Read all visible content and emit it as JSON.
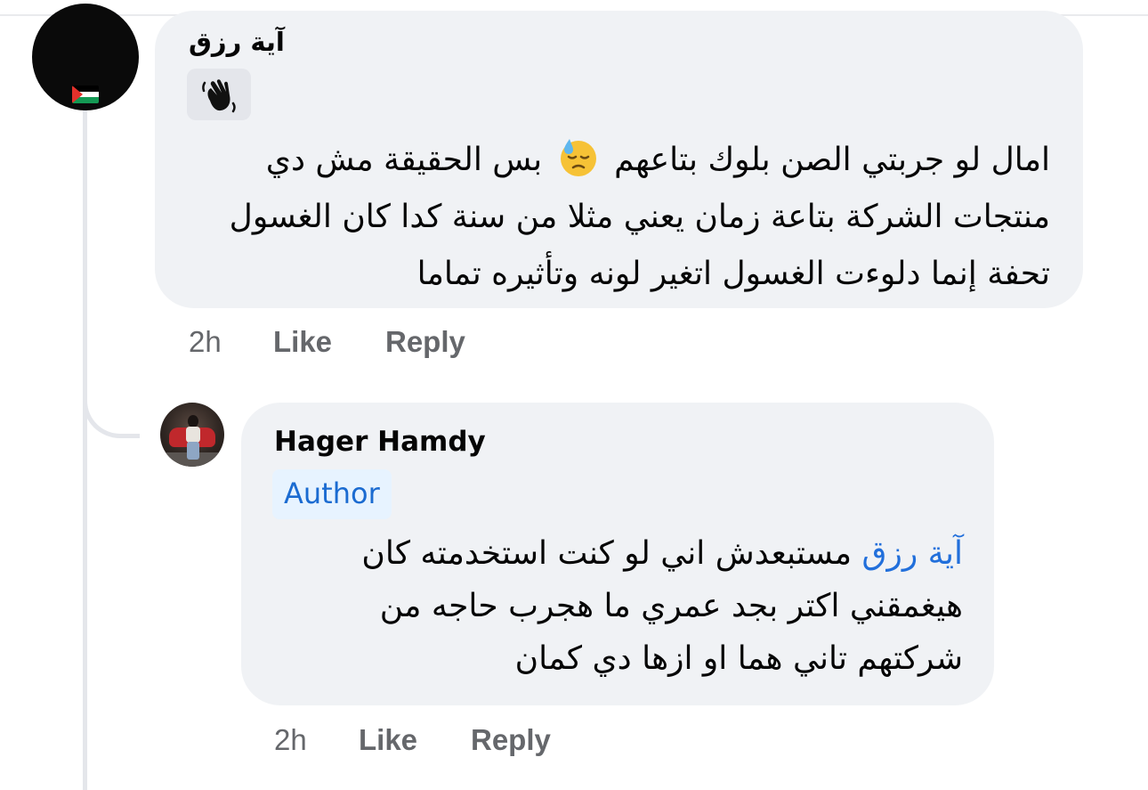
{
  "comment": {
    "author_name": "آية رزق",
    "avatar_badge": "palestine-flag",
    "badge_icon": "waving-hand-icon",
    "text_before_emoji": "امال لو جربتي الصن بلوك بتاعهم",
    "emoji": "downcast-face-with-sweat-icon",
    "text_after_emoji": "بس الحقيقة مش دي منتجات الشركة بتاعة زمان يعني مثلا من سنة كدا كان الغسول تحفة إنما دلوءت الغسول اتغير لونه وتأثيره تماما",
    "time": "2h",
    "like_label": "Like",
    "reply_label": "Reply"
  },
  "reply": {
    "author_name": "Hager Hamdy",
    "author_badge": "Author",
    "mention": "آية رزق",
    "text": "مستبعدش اني لو كنت استخدمته كان هيغمقني اكتر بجد عمري ما هجرب حاجه من شركتهم تاني هما او ازها دي كمان",
    "time": "2h",
    "like_label": "Like",
    "reply_label": "Reply"
  },
  "colors": {
    "bubble": "#f0f2f5",
    "meta_text": "#65676b",
    "mention": "#216fdb",
    "author_badge_bg": "#e7f3ff",
    "author_badge_text": "#1b6bd1"
  }
}
